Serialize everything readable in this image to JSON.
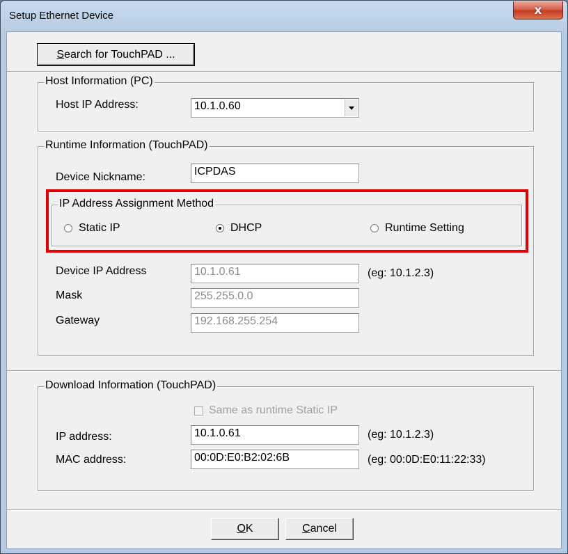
{
  "window": {
    "title": "Setup Ethernet Device",
    "close_glyph": "x"
  },
  "search_button": {
    "accel": "S",
    "label_rest": "earch for TouchPAD ..."
  },
  "host": {
    "legend": "Host Information (PC)",
    "ip_label": "Host IP Address:",
    "ip_value": "10.1.0.60"
  },
  "runtime": {
    "legend": "Runtime Information (TouchPAD)",
    "nickname_label": "Device Nickname:",
    "nickname_value": "ICPDAS",
    "assign": {
      "legend": "IP Address Assignment Method",
      "options": [
        {
          "label": "Static IP",
          "selected": false
        },
        {
          "label": "DHCP",
          "selected": true
        },
        {
          "label": "Runtime Setting",
          "selected": false
        }
      ]
    },
    "ip_label": "Device IP Address",
    "ip_value": "10.1.0.61",
    "ip_hint": "(eg: 10.1.2.3)",
    "mask_label": "Mask",
    "mask_value": "255.255.0.0",
    "gateway_label": "Gateway",
    "gateway_value": "192.168.255.254"
  },
  "download": {
    "legend": "Download Information (TouchPAD)",
    "same_label": "Same as runtime Static IP",
    "ip_label": "IP address:",
    "ip_value": "10.1.0.61",
    "ip_hint": "(eg: 10.1.2.3)",
    "mac_label": "MAC address:",
    "mac_value": "00:0D:E0:B2:02:6B",
    "mac_hint": "(eg: 00:0D:E0:11:22:33)"
  },
  "buttons": {
    "ok_accel": "O",
    "ok_rest": "K",
    "cancel_accel": "C",
    "cancel_rest": "ancel"
  },
  "colors": {
    "highlight": "#e00000",
    "title_bar": "#bcd1e8",
    "close_button": "#c43a24"
  }
}
